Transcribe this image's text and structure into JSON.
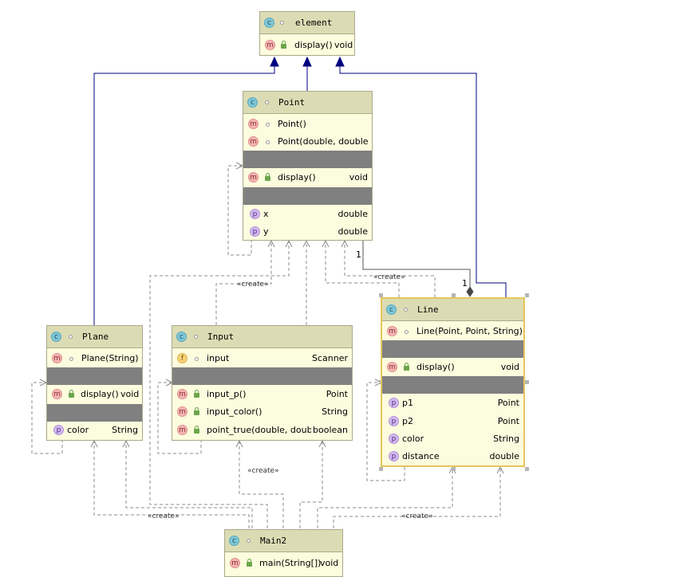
{
  "classes": {
    "element": {
      "name": "element",
      "method_name": "display()",
      "method_type": "void"
    },
    "point": {
      "name": "Point",
      "ctor1": "Point()",
      "ctor2": "Point(double, double)",
      "method_name": "display()",
      "method_type": "void",
      "field1_name": "x",
      "field1_type": "double",
      "field2_name": "y",
      "field2_type": "double"
    },
    "plane": {
      "name": "Plane",
      "ctor": "Plane(String)",
      "method_name": "display()",
      "method_type": "void",
      "field_name": "color",
      "field_type": "String"
    },
    "input": {
      "name": "Input",
      "field_name": "input",
      "field_type": "Scanner",
      "m1_name": "input_p()",
      "m1_type": "Point",
      "m2_name": "input_color()",
      "m2_type": "String",
      "m3_name": "point_true(double, double)",
      "m3_type": "boolean"
    },
    "line": {
      "name": "Line",
      "ctor": "Line(Point, Point, String)",
      "method_name": "display()",
      "method_type": "void",
      "f1_name": "p1",
      "f1_type": "Point",
      "f2_name": "p2",
      "f2_type": "Point",
      "f3_name": "color",
      "f3_type": "String",
      "f4_name": "distance",
      "f4_type": "double"
    },
    "main2": {
      "name": "Main2",
      "method_name": "main(String[])",
      "method_type": "void"
    }
  },
  "badges": {
    "class": "c",
    "method": "m",
    "property": "p",
    "field": "f"
  },
  "stereotypes": {
    "create1": "«create»",
    "create2": "«create»",
    "create3": "«create»",
    "create4": "«create»",
    "create5": "«create»"
  },
  "multiplicities": {
    "m1": "1",
    "m2": "1"
  },
  "colors": {
    "inheritance": "#00007f",
    "dependency": "#8c8c8c",
    "composition": "#555555",
    "class_header": "#dcdcb4",
    "class_body": "#fcfcde"
  }
}
